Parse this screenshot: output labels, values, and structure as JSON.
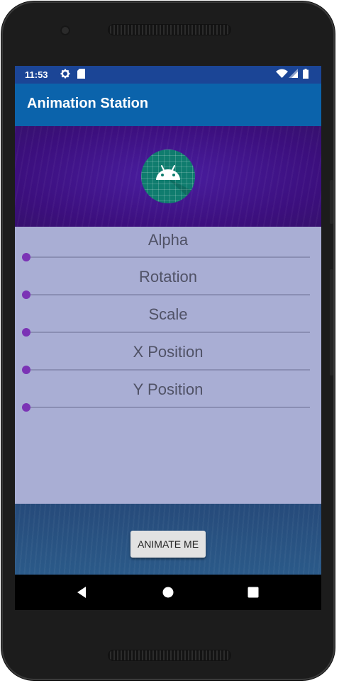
{
  "status_bar": {
    "time": "11:53",
    "icons": [
      "settings-icon",
      "sd-card-icon",
      "wifi-icon",
      "signal-icon",
      "battery-icon"
    ]
  },
  "app_bar": {
    "title": "Animation Station"
  },
  "header": {
    "logo_icon": "android-logo-icon"
  },
  "controls": [
    {
      "label": "Alpha",
      "value": 0
    },
    {
      "label": "Rotation",
      "value": 0
    },
    {
      "label": "Scale",
      "value": 0
    },
    {
      "label": "X Position",
      "value": 0
    },
    {
      "label": "Y Position",
      "value": 0
    }
  ],
  "footer": {
    "button_label": "ANIMATE ME"
  },
  "nav_bar": {
    "icons": [
      "back-icon",
      "home-icon",
      "recents-icon"
    ]
  },
  "colors": {
    "status_bar": "#1b4596",
    "app_bar": "#0b63ab",
    "header": "#3c0f7e",
    "controls_bg": "#a9aed4",
    "slider_thumb": "#7b33b5",
    "footer": "#264a7a"
  }
}
